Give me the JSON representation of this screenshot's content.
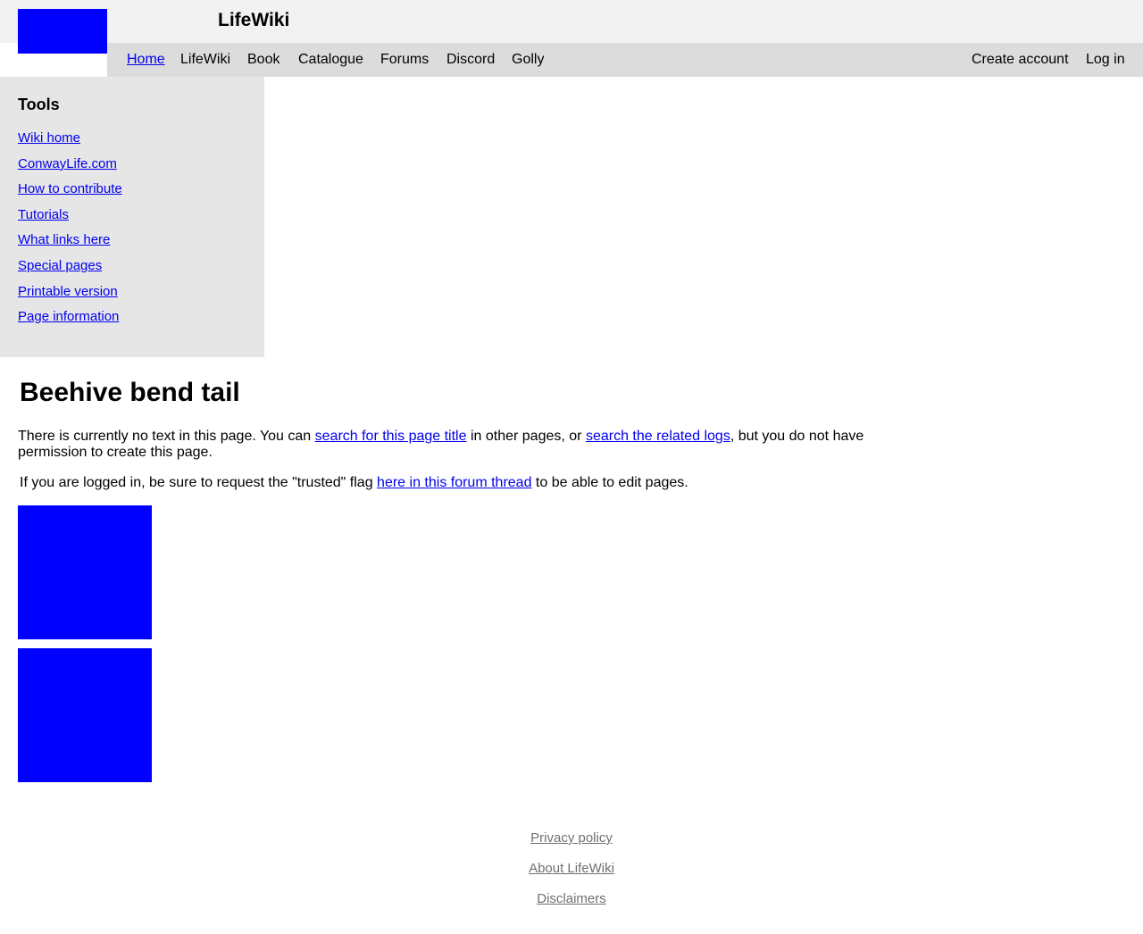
{
  "header": {
    "site_title": "LifeWiki",
    "logo_icon": "lifewiki-logo-icon"
  },
  "nav": {
    "items": [
      "Home",
      "LifeWiki",
      "Book",
      "Catalogue",
      "Forums",
      "Discord",
      "Golly"
    ],
    "create_account": "Create account",
    "log_in": "Log in"
  },
  "sidebar": {
    "heading": "Tools",
    "items": [
      "Wiki home",
      "ConwayLife.com",
      "How to contribute",
      "Tutorials",
      "What links here",
      "Special pages",
      "Printable version",
      "Page information"
    ]
  },
  "main": {
    "title": "Beehive bend tail",
    "notice": {
      "prefix": "There is currently no text in this page. You can ",
      "link1": "search for this page title",
      "middle": " in other pages, or ",
      "link2": "search the related logs",
      "suffix": ", but you do not have permission to create this page."
    },
    "notice2": {
      "prefix": "If you are logged in, be sure to request the \"trusted\" flag ",
      "link": "here in this forum thread",
      "suffix": " to be able to edit pages."
    }
  },
  "footer": {
    "links": [
      "Privacy policy",
      "About LifeWiki",
      "Disclaimers"
    ]
  },
  "colors": {
    "link": "#0000ee",
    "placeholder_image": "#0000ff",
    "topbar_bg": "#f2f2f2",
    "navbar_bg": "#dcdcdc",
    "sidebar_bg": "#e6e6e6",
    "footer_link": "#707070"
  }
}
